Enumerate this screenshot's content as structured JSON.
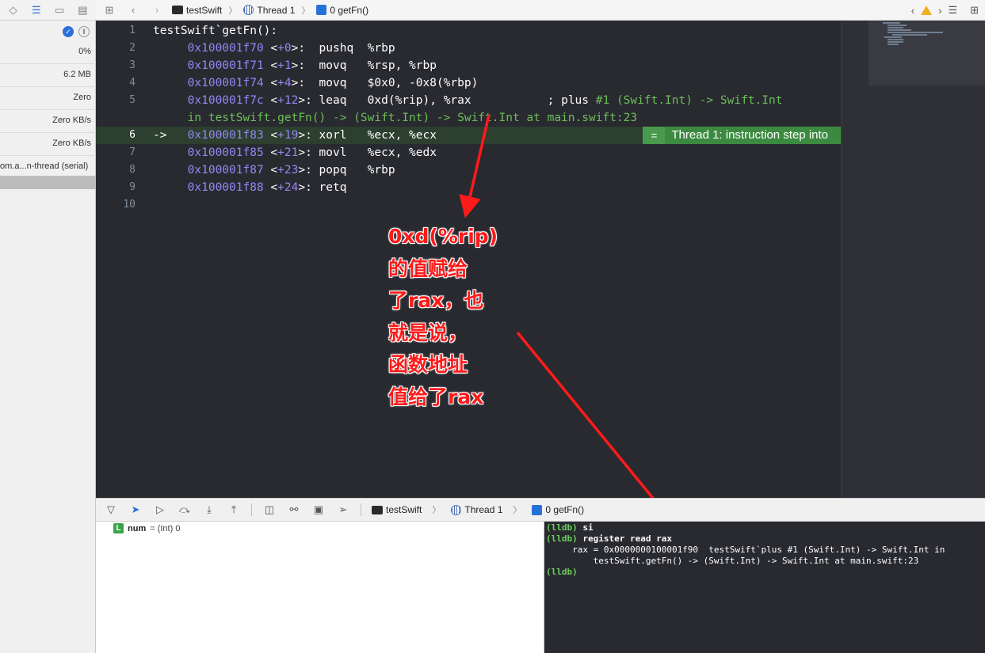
{
  "left_panel": {
    "gauges": [
      {
        "name": "cpu",
        "value": "0%"
      },
      {
        "name": "memory",
        "value": "6.2 MB"
      },
      {
        "name": "energy",
        "value": "Zero"
      },
      {
        "name": "disk",
        "value": "Zero KB/s"
      },
      {
        "name": "network",
        "value": "Zero KB/s"
      }
    ],
    "thread_label": "om.a...n-thread (serial)"
  },
  "jump_bar": {
    "project": "testSwift",
    "thread": "Thread 1",
    "frame": "0 getFn()"
  },
  "editor": {
    "lines": [
      {
        "n": "1",
        "indent": "",
        "addr": "",
        "offset": "",
        "instr": "testSwift`getFn():",
        "comment": ""
      },
      {
        "n": "2",
        "indent": "    ",
        "addr": "0x100001f70",
        "offset": "+0",
        "instr": ":  pushq  %rbp",
        "comment": ""
      },
      {
        "n": "3",
        "indent": "    ",
        "addr": "0x100001f71",
        "offset": "+1",
        "instr": ":  movq   %rsp, %rbp",
        "comment": ""
      },
      {
        "n": "4",
        "indent": "    ",
        "addr": "0x100001f74",
        "offset": "+4",
        "instr": ":  movq   $0x0, -0x8(%rbp)",
        "comment": ""
      },
      {
        "n": "5",
        "indent": "    ",
        "addr": "0x100001f7c",
        "offset": "+12",
        "instr": ": leaq   0xd(%rip), %rax",
        "comment": "; plus #1 (Swift.Int) -> Swift.Int"
      },
      {
        "n": "",
        "indent": "",
        "addr": "",
        "offset": "",
        "instr": "",
        "comment": "in testSwift.getFn() -> (Swift.Int) -> Swift.Int at main.swift:23"
      },
      {
        "n": "6",
        "indent": "->  ",
        "addr": "0x100001f83",
        "offset": "+19",
        "instr": ": xorl   %ecx, %ecx",
        "comment": ""
      },
      {
        "n": "7",
        "indent": "    ",
        "addr": "0x100001f85",
        "offset": "+21",
        "instr": ": movl   %ecx, %edx",
        "comment": ""
      },
      {
        "n": "8",
        "indent": "    ",
        "addr": "0x100001f87",
        "offset": "+23",
        "instr": ": popq   %rbp",
        "comment": ""
      },
      {
        "n": "9",
        "indent": "    ",
        "addr": "0x100001f88",
        "offset": "+24",
        "instr": ": retq",
        "comment": ""
      },
      {
        "n": "10",
        "indent": "",
        "addr": "",
        "offset": "",
        "instr": "",
        "comment": ""
      }
    ],
    "pc_badge": "Thread 1: instruction step into",
    "pc_badge_icon": "="
  },
  "annotation": {
    "text": "0xd(%rip)\n的值赋给\n了rax，也\n就是说，\n函数地址\n值给了rax"
  },
  "debug_bar": {
    "project": "testSwift",
    "thread": "Thread 1",
    "frame": "0 getFn()"
  },
  "variables": {
    "badge": "L",
    "name": "num",
    "type_value": "= (Int) 0"
  },
  "console": {
    "lines": [
      {
        "prompt": "(lldb)",
        "text": " si",
        "bold": true
      },
      {
        "prompt": "(lldb)",
        "text": " register read rax",
        "bold": true
      },
      {
        "prompt": "",
        "text": "     rax = 0x0000000100001f90  testSwift`plus #1 (Swift.Int) -> Swift.Int in",
        "bold": false
      },
      {
        "prompt": "",
        "text": "         testSwift.getFn() -> (Swift.Int) -> Swift.Int at main.swift:23",
        "bold": false
      },
      {
        "prompt": "(lldb)",
        "text": "",
        "bold": false
      }
    ]
  },
  "colors": {
    "editor_bg": "#292a30",
    "address": "#9686f5",
    "comment": "#6bbf59",
    "current_line": "#2d3f2f",
    "badge": "#3c8a40",
    "annotation": "#ff1a1a"
  }
}
